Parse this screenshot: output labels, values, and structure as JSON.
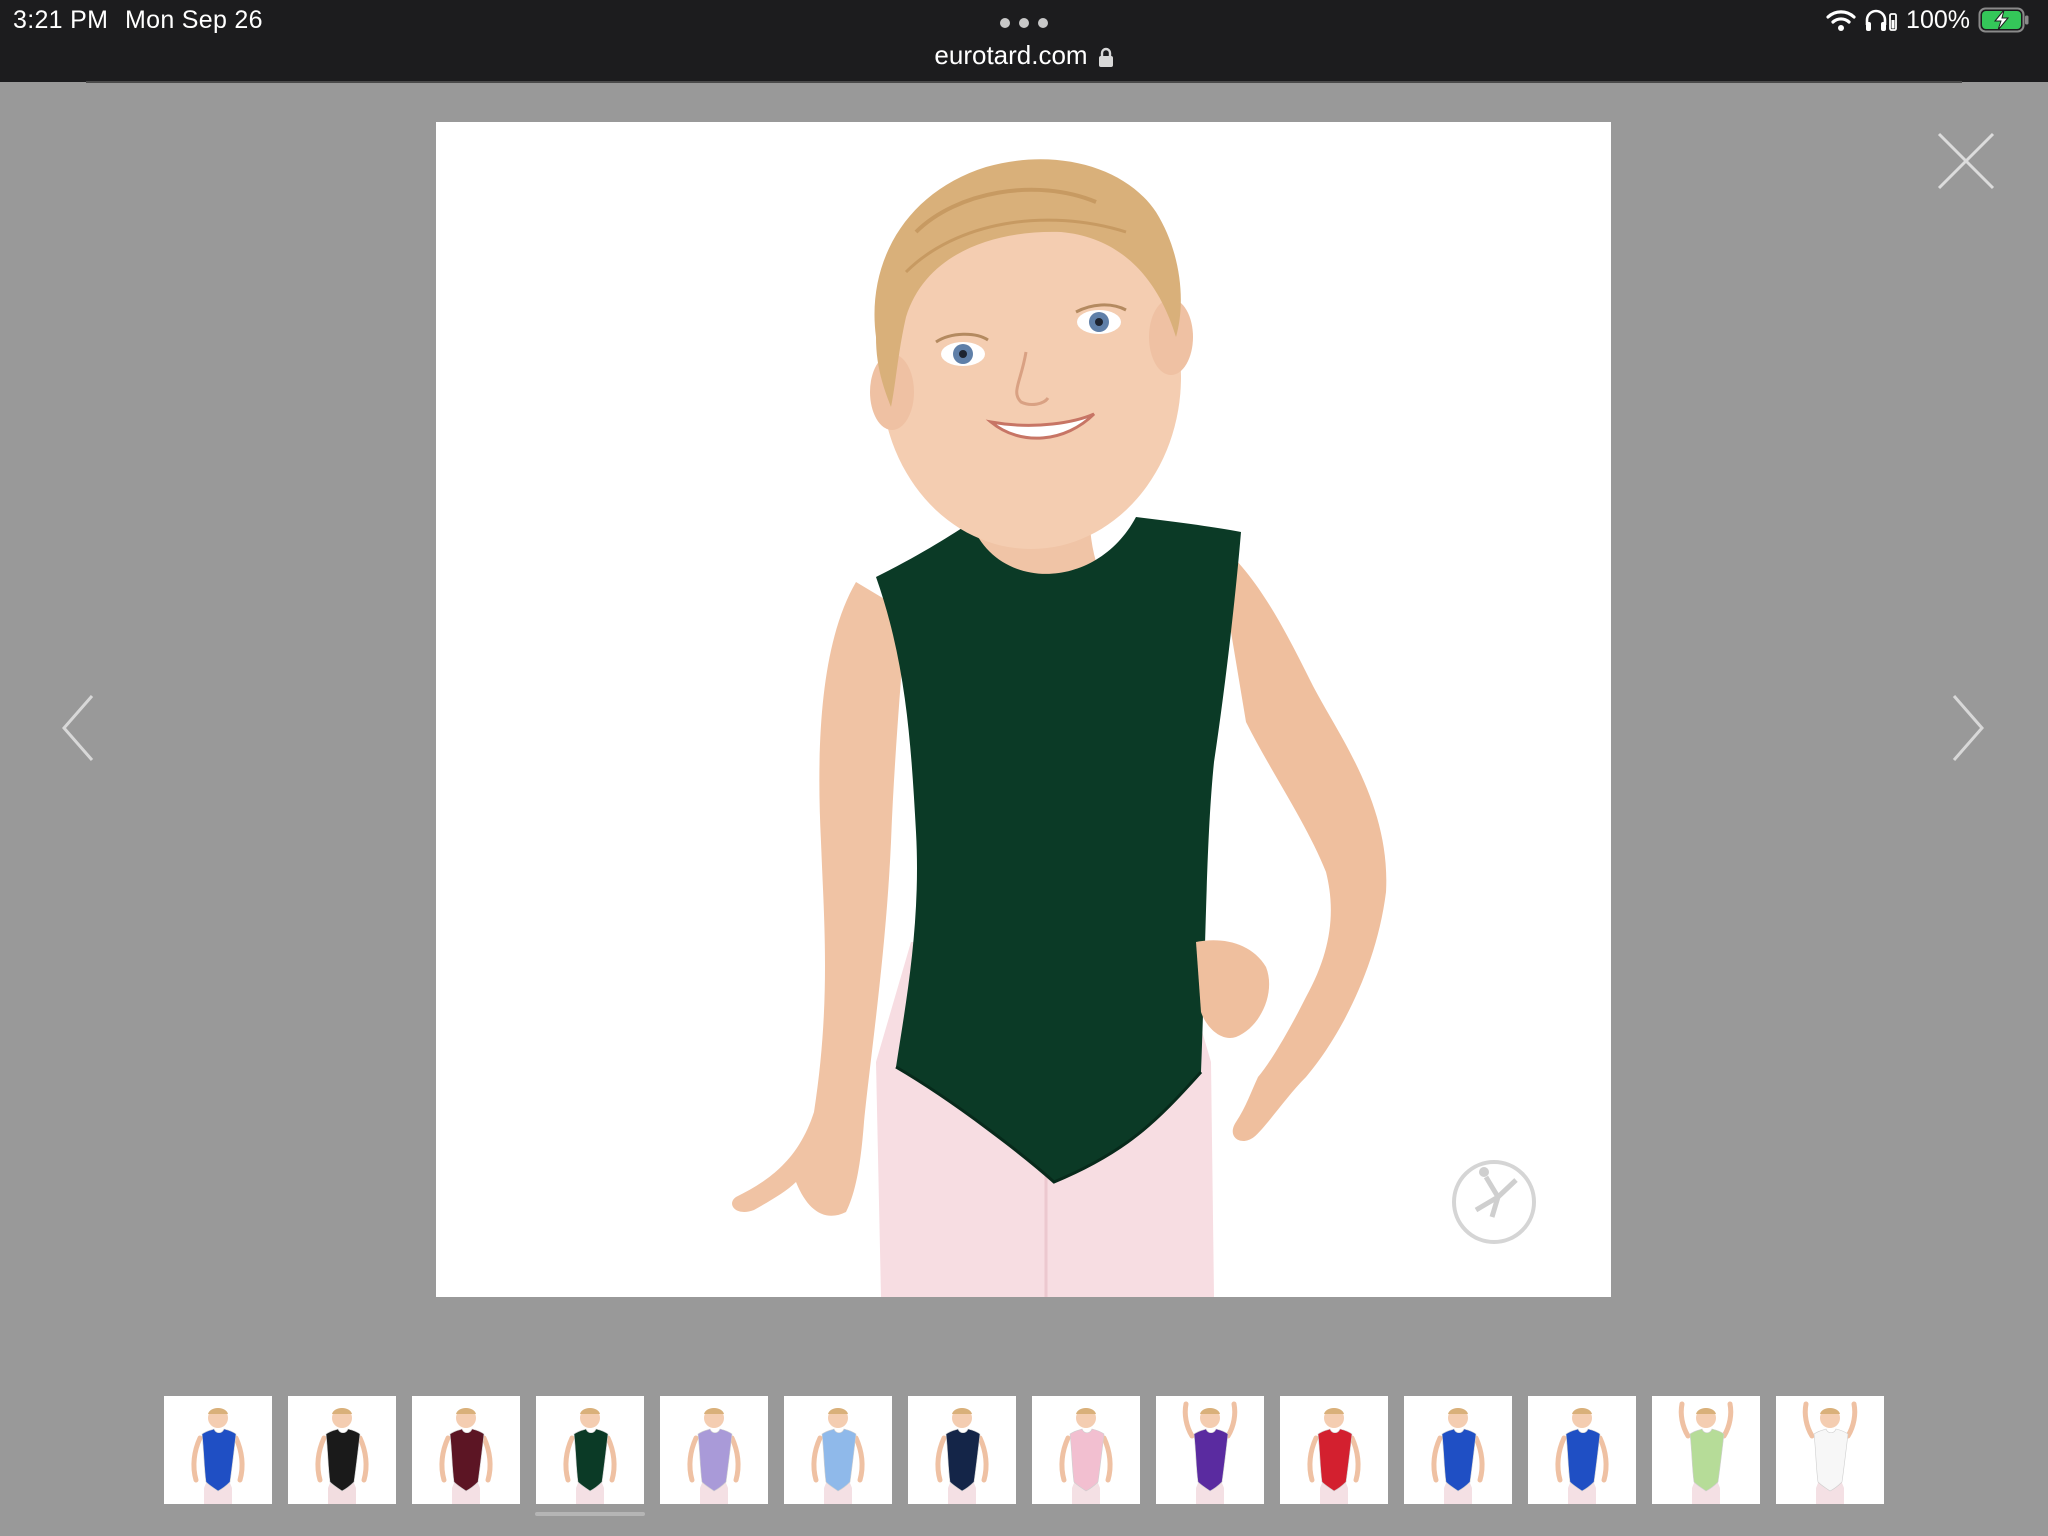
{
  "status_bar": {
    "time": "3:21 PM",
    "date": "Mon Sep 26",
    "url": "eurotard.com",
    "battery": "100%"
  },
  "colors": {
    "backdrop": "#999999",
    "main_leotard": "#0b3a26"
  },
  "icons": [
    "more-dots-icon",
    "lock-icon",
    "wifi-icon",
    "headphones-icon",
    "battery-charging-icon",
    "close-icon",
    "chevron-left-icon",
    "chevron-right-icon",
    "brand-dancer-logo-icon"
  ],
  "thumbnails": [
    {
      "color": "#1f4fc4",
      "pose": "standing"
    },
    {
      "color": "#1a1a1a",
      "pose": "standing"
    },
    {
      "color": "#5c1524",
      "pose": "standing"
    },
    {
      "color": "#0b3a26",
      "pose": "standing"
    },
    {
      "color": "#a99ad8",
      "pose": "standing"
    },
    {
      "color": "#8fb9ea",
      "pose": "standing"
    },
    {
      "color": "#142548",
      "pose": "standing"
    },
    {
      "color": "#f2bfd0",
      "pose": "standing"
    },
    {
      "color": "#5a2ba0",
      "pose": "arms-up"
    },
    {
      "color": "#d3202f",
      "pose": "standing"
    },
    {
      "color": "#1f4fc4",
      "pose": "standing"
    },
    {
      "color": "#1f4fc4",
      "pose": "standing"
    },
    {
      "color": "#b6dc98",
      "pose": "arms-up"
    },
    {
      "color": "#f7f7f7",
      "pose": "arms-up"
    }
  ],
  "selected_thumbnail_index": 3
}
